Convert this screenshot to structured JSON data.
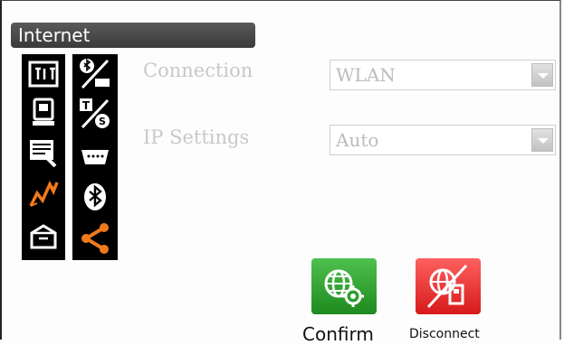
{
  "window": {
    "title": "Internet"
  },
  "left_icons": {
    "col1": [
      "keyboard-icon",
      "surveying-instrument-icon",
      "document-settings-icon",
      "signal-chart-icon",
      "printer-box-icon"
    ],
    "col2": [
      "bluetooth-serial-icon",
      "toggle-ts-icon",
      "serial-port-icon",
      "bluetooth-icon",
      "share-network-icon"
    ],
    "highlight_color": "#f07a1a"
  },
  "form": {
    "connection_label": "Connection",
    "connection_value": "WLAN",
    "ip_label": "IP Settings",
    "ip_value": "Auto"
  },
  "buttons": {
    "confirm_label": "Confirm",
    "disconnect_label": "Disconnect",
    "confirm_color": "#2e9e2e",
    "disconnect_color": "#e52b2b"
  }
}
